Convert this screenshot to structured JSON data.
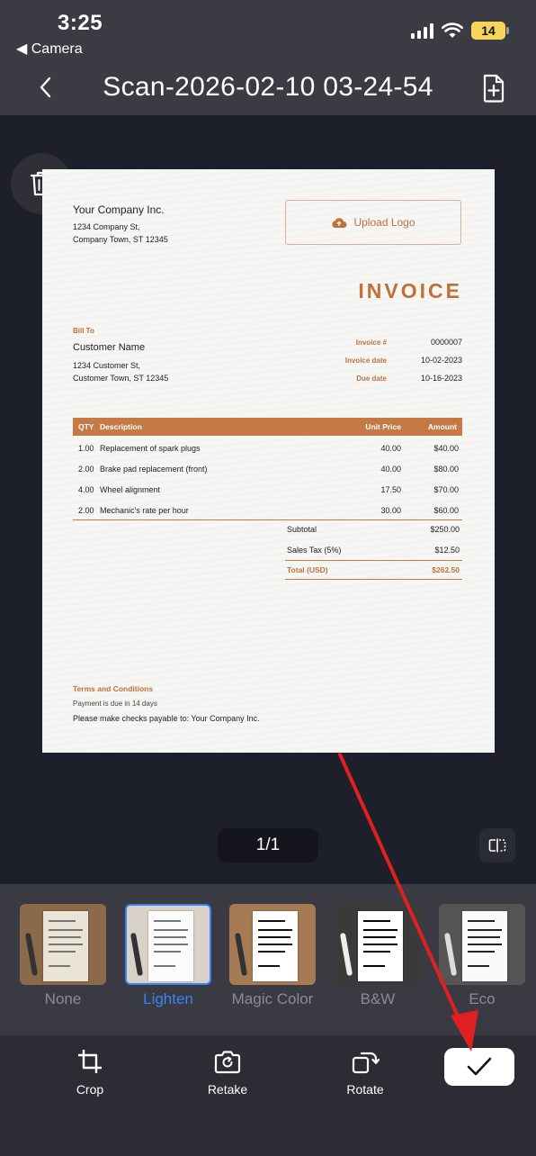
{
  "status_bar": {
    "time": "3:25",
    "back_app": "◀ Camera",
    "battery": "14"
  },
  "header": {
    "title": "Scan-2026-02-10 03-24-54"
  },
  "invoice": {
    "company_name": "Your Company Inc.",
    "company_address_1": "1234 Company St,",
    "company_address_2": "Company Town, ST 12345",
    "upload_logo": "Upload Logo",
    "title": "INVOICE",
    "bill_to_label": "Bill To",
    "customer_name": "Customer Name",
    "customer_address_1": "1234 Customer St,",
    "customer_address_2": "Customer Town, ST 12345",
    "meta": [
      {
        "label": "Invoice #",
        "value": "0000007"
      },
      {
        "label": "Invoice date",
        "value": "10-02-2023"
      },
      {
        "label": "Due date",
        "value": "10-16-2023"
      }
    ],
    "table_headers": {
      "qty": "QTY",
      "description": "Description",
      "unit_price": "Unit Price",
      "amount": "Amount"
    },
    "items": [
      {
        "qty": "1.00",
        "description": "Replacement of spark plugs",
        "unit_price": "40.00",
        "amount": "$40.00"
      },
      {
        "qty": "2.00",
        "description": "Brake pad replacement (front)",
        "unit_price": "40.00",
        "amount": "$80.00"
      },
      {
        "qty": "4.00",
        "description": "Wheel alignment",
        "unit_price": "17.50",
        "amount": "$70.00"
      },
      {
        "qty": "2.00",
        "description": "Mechanic's rate per hour",
        "unit_price": "30.00",
        "amount": "$60.00"
      }
    ],
    "subtotal_label": "Subtotal",
    "subtotal_value": "$250.00",
    "tax_label": "Sales Tax (5%)",
    "tax_value": "$12.50",
    "total_label": "Total (USD)",
    "total_value": "$262.50",
    "terms_title": "Terms and Conditions",
    "terms_line_1": "Payment is due in 14 days",
    "terms_line_2": "Please make checks payable to: Your Company Inc."
  },
  "page_indicator": "1/1",
  "filters": [
    {
      "label": "None",
      "selected": false
    },
    {
      "label": "Lighten",
      "selected": true
    },
    {
      "label": "Magic Color",
      "selected": false
    },
    {
      "label": "B&W",
      "selected": false
    },
    {
      "label": "Eco",
      "selected": false
    }
  ],
  "toolbar": {
    "crop": "Crop",
    "retake": "Retake",
    "rotate": "Rotate"
  },
  "colors": {
    "accent_blue": "#3b82f6",
    "invoice_orange": "#c0703b",
    "annotation_red": "#e02020"
  }
}
